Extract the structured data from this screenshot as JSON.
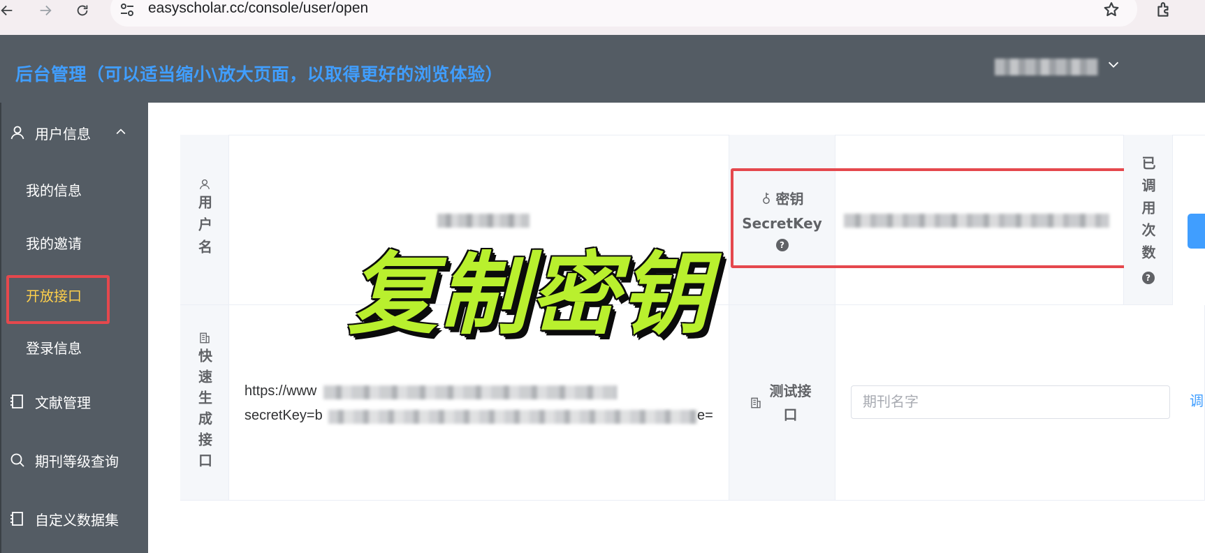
{
  "browser": {
    "url": "easyscholar.cc/console/user/open"
  },
  "header": {
    "title": "后台管理（可以适当缩小\\放大页面，以取得更好的浏览体验）"
  },
  "sidebar": {
    "groups": [
      {
        "label": "用户信息",
        "icon": "user-icon"
      },
      {
        "label": "文献管理",
        "icon": "book-icon"
      },
      {
        "label": "期刊等级查询",
        "icon": "search-icon"
      },
      {
        "label": "自定义数据集",
        "icon": "book-icon"
      }
    ],
    "sub_items": [
      {
        "label": "我的信息"
      },
      {
        "label": "我的邀请"
      },
      {
        "label": "开放接口",
        "active": true
      },
      {
        "label": "登录信息"
      }
    ]
  },
  "table": {
    "username_label": "用户名",
    "secret_label_cn": "密钥",
    "secret_label_en": "SecretKey",
    "calls_label": "已调用次数",
    "quick_api_label": "快速生成接口",
    "test_api_label": "测试接口",
    "api_url_line1": "https://www",
    "api_url_line2": "secretKey=b",
    "api_url_line2_end": "e="
  },
  "test": {
    "placeholder": "期刊名字",
    "call_label": "调"
  },
  "overlay": {
    "caption": "复制密钥"
  },
  "colors": {
    "header_bg": "#545c64",
    "accent": "#409eff",
    "active_menu": "#ffd04b",
    "highlight": "#e5484d",
    "caption_fill": "#b9f02e"
  }
}
